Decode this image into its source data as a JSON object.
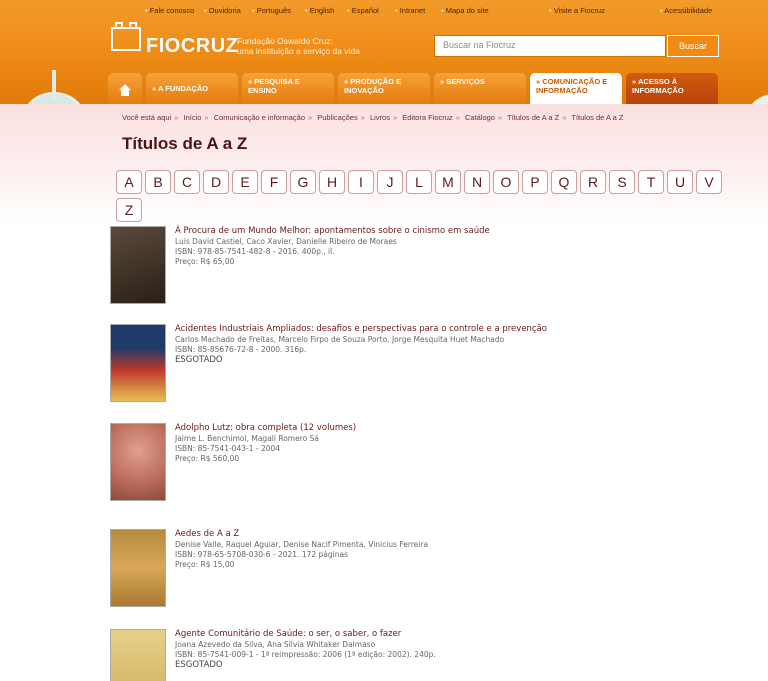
{
  "topbar": [
    "Fale conosco",
    "Ouvidoria",
    "Português",
    "English",
    "Español",
    "Intranet",
    "Mapa do site",
    "Visite a Fiocruz",
    "Acessibilidade"
  ],
  "logo": {
    "name": "FIOCRUZ",
    "subtitle_1": "Fundação Oswaldo Cruz:",
    "subtitle_2": "uma instituição a serviço da vida"
  },
  "search": {
    "placeholder": "Buscar na Fiocruz",
    "button": "Buscar"
  },
  "nav": [
    {
      "label": ""
    },
    {
      "label": "A FUNDAÇÃO"
    },
    {
      "label": "PESQUISA E ENSINO"
    },
    {
      "label": "PRODUÇÃO E INOVAÇÃO"
    },
    {
      "label": "SERVIÇOS"
    },
    {
      "label": "COMUNICAÇÃO E INFORMAÇÃO"
    },
    {
      "label": "ACESSO À INFORMAÇÃO"
    }
  ],
  "breadcrumb": [
    "Você está aqui",
    "Início",
    "Comunicação e informação",
    "Publicações",
    "Livros",
    "Editora Fiocruz",
    "Catálogo",
    "Títulos de A a Z",
    "Títulos de A a Z"
  ],
  "page_title": "Títulos de A a Z",
  "letters": [
    "A",
    "B",
    "C",
    "D",
    "E",
    "F",
    "G",
    "H",
    "I",
    "J",
    "L",
    "M",
    "N",
    "O",
    "P",
    "Q",
    "R",
    "S",
    "T",
    "U",
    "V",
    "Z"
  ],
  "books": [
    {
      "title": "À Procura de um Mundo Melhor: apontamentos sobre o cinismo em saúde",
      "authors": "Luis David Castiel, Caco Xavier, Danielle Ribeiro de Moraes",
      "isbn": "ISBN: 978-85-7541-482-8 - 2016. 400p., il.",
      "status": "Preço: R$ 65,00",
      "cover_color": "#3a2e22"
    },
    {
      "title": "Acidentes Industriais Ampliados: desafios e perspectivas para o controle e a prevenção",
      "authors": "Carlos Machado de Freitas, Marcelo Firpo de Souza Porto, Jorge Mesquita Huet Machado",
      "isbn": "ISBN: 85-85676-72-8 - 2000. 316p.",
      "status": "ESGOTADO",
      "cover_color": "#1d3a6a"
    },
    {
      "title": "Adolpho Lutz: obra completa (12 volumes)",
      "authors": "Jaime L. Benchimol, Magali Romero Sá",
      "isbn": "ISBN: 85-7541-043-1 - 2004",
      "status": "Preço: R$ 560,00",
      "cover_color": "#b96a5a"
    },
    {
      "title": "Aedes de A a Z",
      "authors": "Denise Valle, Raquel Aguiar, Denise Nacif Pimenta, Vinicius Ferreira",
      "isbn": "ISBN: 978-65-5708-030-6 - 2021. 172 páginas",
      "status": "Preço: R$ 15,00",
      "cover_color": "#c89848"
    },
    {
      "title": "Agente Comunitário de Saúde: o ser, o saber, o fazer",
      "authors": "Joana Azevedo da Silva, Ana Silvia Whitaker Dalmaso",
      "isbn": "ISBN: 85-7541-009-1 - 1ª reimpressão: 2006 (1ª edição: 2002). 240p.",
      "status": "ESGOTADO",
      "cover_color": "#d9c070"
    }
  ]
}
